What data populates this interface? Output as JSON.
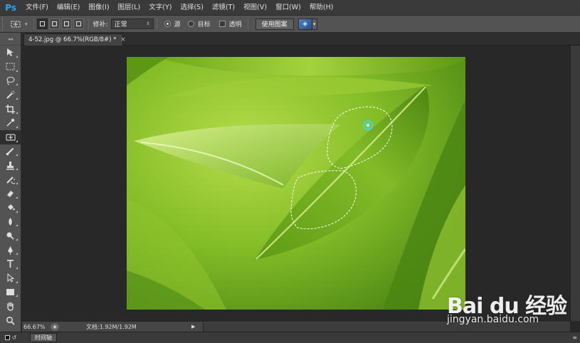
{
  "app": {
    "logo": "Ps"
  },
  "menu": [
    "文件(F)",
    "编辑(E)",
    "图像(I)",
    "图层(L)",
    "文字(Y)",
    "选择(S)",
    "滤镜(T)",
    "视图(V)",
    "窗口(W)",
    "帮助(H)"
  ],
  "options": {
    "tool_icon": "patch-tool-icon",
    "patch_label": "修补:",
    "patch_mode": "正常",
    "radio_source": "源",
    "radio_target": "目标",
    "transparent_label": "透明",
    "use_pattern_button": "使用图案",
    "source_selected": true
  },
  "document": {
    "tab_title": "4-52.jpg @ 66.7%(RGB/8#) *",
    "close_glyph": "×"
  },
  "status": {
    "zoom": "66.67%",
    "doc_size": "文档:1.92M/1.92M"
  },
  "bottom": {
    "timeline_tab": "时间轴"
  },
  "watermark": {
    "line1": "Bai du 经验",
    "line2": "jingyan.baidu.com"
  },
  "tools": [
    "move-icon",
    "marquee-icon",
    "lasso-icon",
    "quick-select-icon",
    "crop-icon",
    "eyedropper-icon",
    "patch-icon",
    "brush-icon",
    "clone-stamp-icon",
    "history-brush-icon",
    "eraser-icon",
    "paint-bucket-icon",
    "blur-icon",
    "dodge-icon",
    "pen-icon",
    "type-icon",
    "path-select-icon",
    "rectangle-icon",
    "hand-icon",
    "zoom-icon"
  ],
  "colors": {
    "accent": "#29a5f5",
    "leaf_dark": "#4f8a12",
    "leaf_light": "#c8e86a"
  }
}
